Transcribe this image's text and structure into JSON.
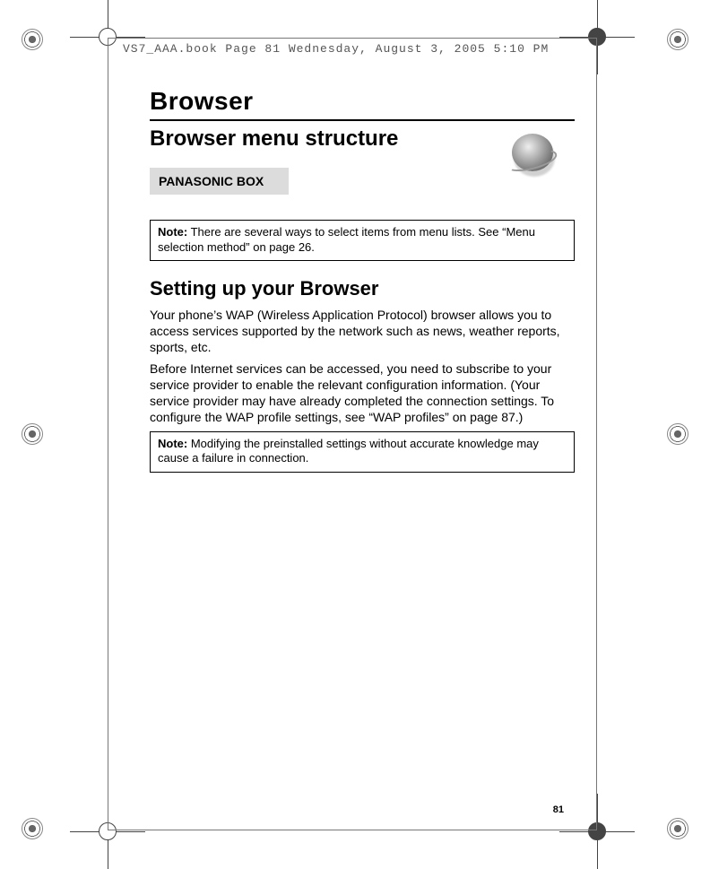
{
  "header_line": "VS7_AAA.book  Page 81  Wednesday, August 3, 2005  5:10 PM",
  "title": "Browser",
  "subtitle": "Browser menu structure",
  "panasonic_box": "PANASONIC BOX",
  "note1": {
    "label": "Note:",
    "text": "There are several ways to select items from menu lists. See “Menu selection method” on page 26."
  },
  "h2": "Setting up your Browser",
  "p1": "Your phone’s WAP (Wireless Application Protocol) browser allows you to access services supported by the network such as news, weather reports, sports, etc.",
  "p2": "Before Internet services can be accessed, you need to subscribe to your service provider to enable the relevant configuration information. (Your service provider may have already completed the connection settings. To configure the WAP profile settings, see “WAP profiles” on page 87.)",
  "note2": {
    "label": "Note:",
    "text": "Modifying the preinstalled settings without accurate knowledge may cause a failure in connection."
  },
  "page_number": "81"
}
